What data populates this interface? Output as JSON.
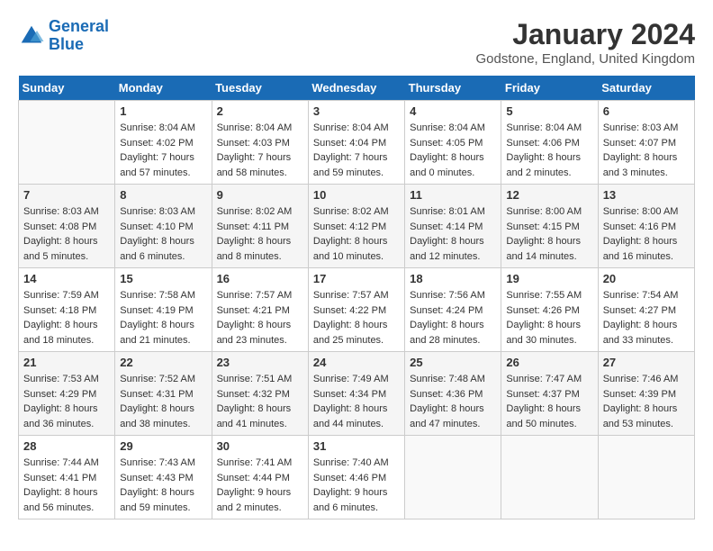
{
  "logo": {
    "line1": "General",
    "line2": "Blue"
  },
  "title": "January 2024",
  "location": "Godstone, England, United Kingdom",
  "headers": [
    "Sunday",
    "Monday",
    "Tuesday",
    "Wednesday",
    "Thursday",
    "Friday",
    "Saturday"
  ],
  "weeks": [
    [
      {
        "day": "",
        "sunrise": "",
        "sunset": "",
        "daylight": ""
      },
      {
        "day": "1",
        "sunrise": "Sunrise: 8:04 AM",
        "sunset": "Sunset: 4:02 PM",
        "daylight": "Daylight: 7 hours and 57 minutes."
      },
      {
        "day": "2",
        "sunrise": "Sunrise: 8:04 AM",
        "sunset": "Sunset: 4:03 PM",
        "daylight": "Daylight: 7 hours and 58 minutes."
      },
      {
        "day": "3",
        "sunrise": "Sunrise: 8:04 AM",
        "sunset": "Sunset: 4:04 PM",
        "daylight": "Daylight: 7 hours and 59 minutes."
      },
      {
        "day": "4",
        "sunrise": "Sunrise: 8:04 AM",
        "sunset": "Sunset: 4:05 PM",
        "daylight": "Daylight: 8 hours and 0 minutes."
      },
      {
        "day": "5",
        "sunrise": "Sunrise: 8:04 AM",
        "sunset": "Sunset: 4:06 PM",
        "daylight": "Daylight: 8 hours and 2 minutes."
      },
      {
        "day": "6",
        "sunrise": "Sunrise: 8:03 AM",
        "sunset": "Sunset: 4:07 PM",
        "daylight": "Daylight: 8 hours and 3 minutes."
      }
    ],
    [
      {
        "day": "7",
        "sunrise": "Sunrise: 8:03 AM",
        "sunset": "Sunset: 4:08 PM",
        "daylight": "Daylight: 8 hours and 5 minutes."
      },
      {
        "day": "8",
        "sunrise": "Sunrise: 8:03 AM",
        "sunset": "Sunset: 4:10 PM",
        "daylight": "Daylight: 8 hours and 6 minutes."
      },
      {
        "day": "9",
        "sunrise": "Sunrise: 8:02 AM",
        "sunset": "Sunset: 4:11 PM",
        "daylight": "Daylight: 8 hours and 8 minutes."
      },
      {
        "day": "10",
        "sunrise": "Sunrise: 8:02 AM",
        "sunset": "Sunset: 4:12 PM",
        "daylight": "Daylight: 8 hours and 10 minutes."
      },
      {
        "day": "11",
        "sunrise": "Sunrise: 8:01 AM",
        "sunset": "Sunset: 4:14 PM",
        "daylight": "Daylight: 8 hours and 12 minutes."
      },
      {
        "day": "12",
        "sunrise": "Sunrise: 8:00 AM",
        "sunset": "Sunset: 4:15 PM",
        "daylight": "Daylight: 8 hours and 14 minutes."
      },
      {
        "day": "13",
        "sunrise": "Sunrise: 8:00 AM",
        "sunset": "Sunset: 4:16 PM",
        "daylight": "Daylight: 8 hours and 16 minutes."
      }
    ],
    [
      {
        "day": "14",
        "sunrise": "Sunrise: 7:59 AM",
        "sunset": "Sunset: 4:18 PM",
        "daylight": "Daylight: 8 hours and 18 minutes."
      },
      {
        "day": "15",
        "sunrise": "Sunrise: 7:58 AM",
        "sunset": "Sunset: 4:19 PM",
        "daylight": "Daylight: 8 hours and 21 minutes."
      },
      {
        "day": "16",
        "sunrise": "Sunrise: 7:57 AM",
        "sunset": "Sunset: 4:21 PM",
        "daylight": "Daylight: 8 hours and 23 minutes."
      },
      {
        "day": "17",
        "sunrise": "Sunrise: 7:57 AM",
        "sunset": "Sunset: 4:22 PM",
        "daylight": "Daylight: 8 hours and 25 minutes."
      },
      {
        "day": "18",
        "sunrise": "Sunrise: 7:56 AM",
        "sunset": "Sunset: 4:24 PM",
        "daylight": "Daylight: 8 hours and 28 minutes."
      },
      {
        "day": "19",
        "sunrise": "Sunrise: 7:55 AM",
        "sunset": "Sunset: 4:26 PM",
        "daylight": "Daylight: 8 hours and 30 minutes."
      },
      {
        "day": "20",
        "sunrise": "Sunrise: 7:54 AM",
        "sunset": "Sunset: 4:27 PM",
        "daylight": "Daylight: 8 hours and 33 minutes."
      }
    ],
    [
      {
        "day": "21",
        "sunrise": "Sunrise: 7:53 AM",
        "sunset": "Sunset: 4:29 PM",
        "daylight": "Daylight: 8 hours and 36 minutes."
      },
      {
        "day": "22",
        "sunrise": "Sunrise: 7:52 AM",
        "sunset": "Sunset: 4:31 PM",
        "daylight": "Daylight: 8 hours and 38 minutes."
      },
      {
        "day": "23",
        "sunrise": "Sunrise: 7:51 AM",
        "sunset": "Sunset: 4:32 PM",
        "daylight": "Daylight: 8 hours and 41 minutes."
      },
      {
        "day": "24",
        "sunrise": "Sunrise: 7:49 AM",
        "sunset": "Sunset: 4:34 PM",
        "daylight": "Daylight: 8 hours and 44 minutes."
      },
      {
        "day": "25",
        "sunrise": "Sunrise: 7:48 AM",
        "sunset": "Sunset: 4:36 PM",
        "daylight": "Daylight: 8 hours and 47 minutes."
      },
      {
        "day": "26",
        "sunrise": "Sunrise: 7:47 AM",
        "sunset": "Sunset: 4:37 PM",
        "daylight": "Daylight: 8 hours and 50 minutes."
      },
      {
        "day": "27",
        "sunrise": "Sunrise: 7:46 AM",
        "sunset": "Sunset: 4:39 PM",
        "daylight": "Daylight: 8 hours and 53 minutes."
      }
    ],
    [
      {
        "day": "28",
        "sunrise": "Sunrise: 7:44 AM",
        "sunset": "Sunset: 4:41 PM",
        "daylight": "Daylight: 8 hours and 56 minutes."
      },
      {
        "day": "29",
        "sunrise": "Sunrise: 7:43 AM",
        "sunset": "Sunset: 4:43 PM",
        "daylight": "Daylight: 8 hours and 59 minutes."
      },
      {
        "day": "30",
        "sunrise": "Sunrise: 7:41 AM",
        "sunset": "Sunset: 4:44 PM",
        "daylight": "Daylight: 9 hours and 2 minutes."
      },
      {
        "day": "31",
        "sunrise": "Sunrise: 7:40 AM",
        "sunset": "Sunset: 4:46 PM",
        "daylight": "Daylight: 9 hours and 6 minutes."
      },
      {
        "day": "",
        "sunrise": "",
        "sunset": "",
        "daylight": ""
      },
      {
        "day": "",
        "sunrise": "",
        "sunset": "",
        "daylight": ""
      },
      {
        "day": "",
        "sunrise": "",
        "sunset": "",
        "daylight": ""
      }
    ]
  ]
}
